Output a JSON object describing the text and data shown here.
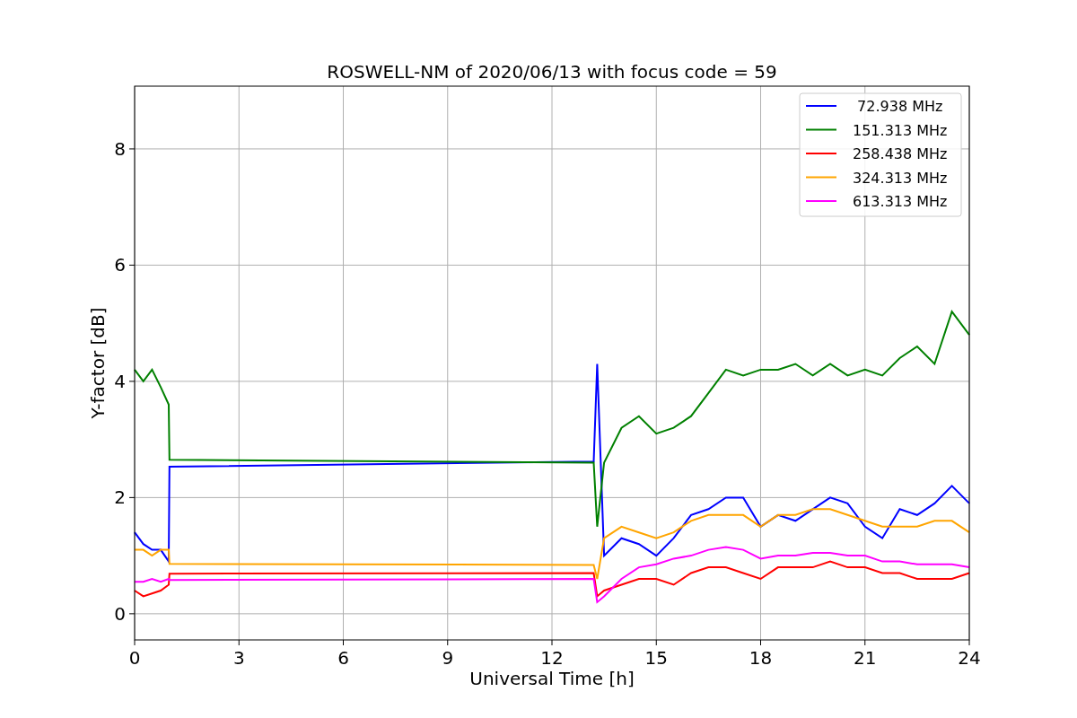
{
  "figure": {
    "chart_data": {
      "type": "line",
      "title": "ROSWELL-NM of 2020/06/13 with focus code = 59",
      "xlabel": "Universal Time [h]",
      "ylabel": "Y-factor [dB]",
      "x": [
        0,
        0.25,
        0.5,
        0.75,
        0.98,
        1.0,
        13.2,
        13.3,
        13.5,
        14,
        14.5,
        15,
        15.5,
        16,
        16.5,
        17,
        17.5,
        18,
        18.5,
        19,
        19.5,
        20,
        20.5,
        21,
        21.5,
        22,
        22.5,
        23,
        23.5,
        24
      ],
      "series": [
        {
          "name": " 72.938 MHz",
          "color": "#0000ff",
          "values": [
            1.4,
            1.2,
            1.1,
            1.1,
            0.9,
            2.53,
            2.62,
            4.3,
            1.0,
            1.3,
            1.2,
            1.0,
            1.3,
            1.7,
            1.8,
            2.0,
            2.0,
            1.5,
            1.7,
            1.6,
            1.8,
            2.0,
            1.9,
            1.5,
            1.3,
            1.8,
            1.7,
            1.9,
            2.2,
            1.9
          ]
        },
        {
          "name": "151.313 MHz",
          "color": "#008000",
          "values": [
            4.2,
            4.0,
            4.2,
            3.9,
            3.6,
            2.65,
            2.6,
            1.5,
            2.6,
            3.2,
            3.4,
            3.1,
            3.2,
            3.4,
            3.8,
            4.2,
            4.1,
            4.2,
            4.2,
            4.3,
            4.1,
            4.3,
            4.1,
            4.2,
            4.1,
            4.4,
            4.6,
            4.3,
            5.2,
            4.8
          ]
        },
        {
          "name": "258.438 MHz",
          "color": "#ff0000",
          "values": [
            0.4,
            0.3,
            0.35,
            0.4,
            0.5,
            0.69,
            0.7,
            0.3,
            0.4,
            0.5,
            0.6,
            0.6,
            0.5,
            0.7,
            0.8,
            0.8,
            0.7,
            0.6,
            0.8,
            0.8,
            0.8,
            0.9,
            0.8,
            0.8,
            0.7,
            0.7,
            0.6,
            0.6,
            0.6,
            0.7
          ]
        },
        {
          "name": "324.313 MHz",
          "color": "#ffa500",
          "values": [
            1.1,
            1.1,
            1.0,
            1.1,
            1.1,
            0.86,
            0.84,
            0.6,
            1.3,
            1.5,
            1.4,
            1.3,
            1.4,
            1.6,
            1.7,
            1.7,
            1.7,
            1.5,
            1.7,
            1.7,
            1.8,
            1.8,
            1.7,
            1.6,
            1.5,
            1.5,
            1.5,
            1.6,
            1.6,
            1.4
          ]
        },
        {
          "name": "613.313 MHz",
          "color": "#ff00ff",
          "values": [
            0.55,
            0.55,
            0.6,
            0.55,
            0.6,
            0.58,
            0.6,
            0.2,
            0.3,
            0.6,
            0.8,
            0.85,
            0.95,
            1.0,
            1.1,
            1.15,
            1.1,
            0.95,
            1.0,
            1.0,
            1.05,
            1.05,
            1.0,
            1.0,
            0.9,
            0.9,
            0.85,
            0.85,
            0.85,
            0.8
          ]
        }
      ],
      "xlim": [
        0,
        24
      ],
      "ylim": [
        -0.45,
        9.08
      ],
      "xticks": [
        0,
        3,
        6,
        9,
        12,
        15,
        18,
        21,
        24
      ],
      "yticks": [
        0,
        2,
        4,
        6,
        8
      ],
      "grid": true,
      "legend": "upper right"
    }
  }
}
